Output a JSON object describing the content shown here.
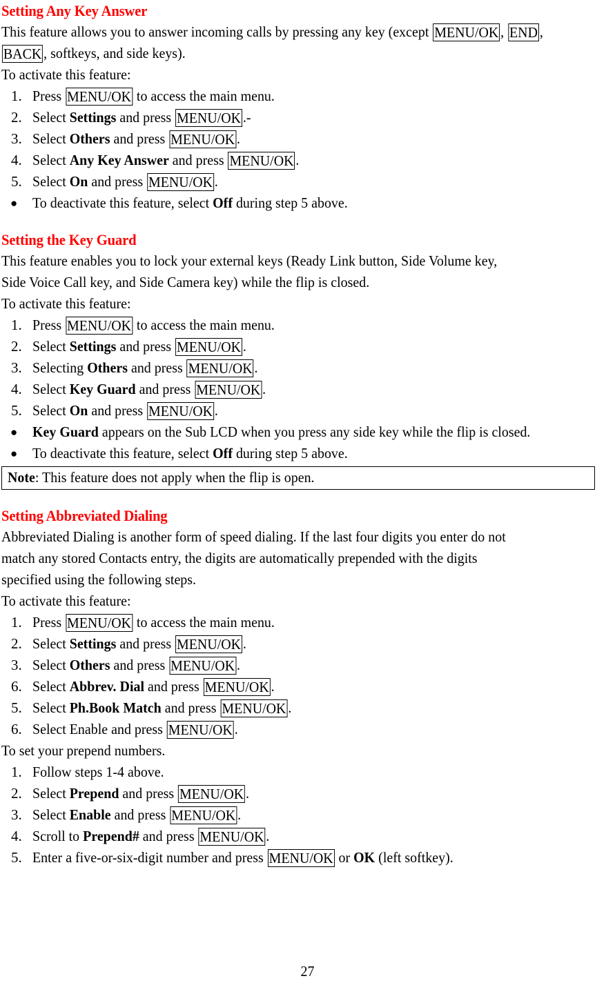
{
  "document": {
    "page_number": "27",
    "heading_color": "#FF0000",
    "body_color": "#000000"
  },
  "sections": [
    {
      "heading": "Setting Any Key Answer",
      "intro_lines": [
        {
          "pre": "This feature allows you to answer incoming calls by pressing any key (except ",
          "key1": "MENU/OK",
          "mid": ", ",
          "key2": "END",
          "post": ","
        },
        {
          "key1": "BACK",
          "post": ", softkeys, and side keys)."
        }
      ],
      "activate_label": "To activate this feature:",
      "steps": [
        {
          "marker": "1.",
          "pre": "Press ",
          "key": "MENU/OK",
          "post": " to access the main menu."
        },
        {
          "marker": "2.",
          "pre": "Select ",
          "bold": "Settings",
          "mid": " and press ",
          "key": "MENU/OK",
          "post": ".-"
        },
        {
          "marker": "3.",
          "pre": "Select ",
          "bold": "Others",
          "mid": " and press ",
          "key": "MENU/OK",
          "post": "."
        },
        {
          "marker": "4.",
          "pre": "Select ",
          "bold": "Any Key Answer",
          "mid": " and press ",
          "key": "MENU/OK",
          "post": "."
        },
        {
          "marker": "5.",
          "pre": "Select ",
          "bold": "On",
          "mid": " and press ",
          "key": "MENU/OK",
          "post": "."
        }
      ],
      "bullets": [
        {
          "marker": "●",
          "pre": "To deactivate this feature, select ",
          "bold": "Off",
          "post": " during step 5 above."
        }
      ]
    },
    {
      "heading": "Setting the Key Guard",
      "intro_lines": [
        {
          "pre": "This feature enables you to lock your external keys (Ready Link button, Side Volume key,"
        },
        {
          "pre": "Side Voice Call key, and Side Camera key) while the flip is closed."
        }
      ],
      "activate_label": "To activate this feature:",
      "steps": [
        {
          "marker": "1.",
          "pre": "Press ",
          "key": "MENU/OK",
          "post": " to access the main menu."
        },
        {
          "marker": "2.",
          "pre": "Select ",
          "bold": "Settings",
          "mid": " and press ",
          "key": "MENU/OK",
          "post": "."
        },
        {
          "marker": "3.",
          "pre": "Selecting ",
          "bold": "Others",
          "mid": " and press ",
          "key": "MENU/OK",
          "post": "."
        },
        {
          "marker": "4.",
          "pre": "Select ",
          "bold": "Key Guard",
          "mid": " and press ",
          "key": "MENU/OK",
          "post": "."
        },
        {
          "marker": "5.",
          "pre": "Select ",
          "bold": "On",
          "mid": " and press ",
          "key": "MENU/OK",
          "post": "."
        }
      ],
      "bullets": [
        {
          "marker": "●",
          "bold_lead": "Key Guard",
          "post": " appears on the Sub LCD when you press any side key while the flip is closed."
        },
        {
          "marker": "●",
          "pre": "To deactivate this feature, select ",
          "bold": "Off",
          "post": " during step 5 above."
        }
      ],
      "note": {
        "label": "Note",
        "text": ": This feature does not apply when the flip is open."
      }
    },
    {
      "heading": "Setting Abbreviated Dialing",
      "intro_lines": [
        {
          "pre": "Abbreviated Dialing is another form of speed dialing. If the last four digits you enter do not"
        },
        {
          "pre": "match any stored Contacts entry, the digits are automatically prepended with the digits"
        },
        {
          "pre": "specified using the following steps."
        }
      ],
      "activate_label": "To activate this feature:",
      "steps": [
        {
          "marker": "1.",
          "pre": "Press ",
          "key": "MENU/OK",
          "post": " to access the main menu."
        },
        {
          "marker": "2.",
          "pre": "Select ",
          "bold": "Settings",
          "mid": " and press ",
          "key": "MENU/OK",
          "post": "."
        },
        {
          "marker": "3.",
          "pre": "Select ",
          "bold": "Others",
          "mid": " and press ",
          "key": "MENU/OK",
          "post": "."
        },
        {
          "marker": "6.",
          "pre": "Select ",
          "bold": "Abbrev. Dial",
          "mid": " and press ",
          "key": "MENU/OK",
          "post": "."
        },
        {
          "marker": "5.",
          "pre": "Select ",
          "bold": "Ph.Book Match",
          "mid": " and press ",
          "key": "MENU/OK",
          "post": "."
        },
        {
          "marker": "6.",
          "pre": "Select Enable and press ",
          "key": "MENU/OK",
          "post": "."
        }
      ],
      "subsection_label": "To set your prepend numbers.",
      "sub_steps": [
        {
          "marker": "1.",
          "pre": "Follow steps 1-4 above."
        },
        {
          "marker": "2.",
          "pre": "Select ",
          "bold": "Prepend",
          "mid": " and press ",
          "key": "MENU/OK",
          "post": "."
        },
        {
          "marker": "3.",
          "pre": "Select ",
          "bold": "Enable",
          "mid": " and press ",
          "key": "MENU/OK",
          "post": "."
        },
        {
          "marker": "4.",
          "pre": "Scroll to ",
          "bold": "Prepend#",
          "mid": " and press ",
          "key": "MENU/OK",
          "post": "."
        },
        {
          "marker": "5.",
          "pre": "Enter a five-or-six-digit number and press ",
          "key": "MENU/OK",
          "mid": " or ",
          "bold": "OK",
          "post": " (left softkey)."
        }
      ]
    }
  ]
}
